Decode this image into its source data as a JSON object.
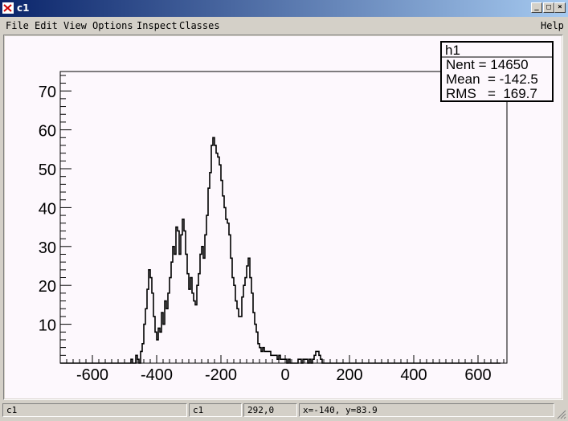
{
  "window": {
    "title": "c1"
  },
  "menu": {
    "items": [
      "File",
      "Edit",
      "View",
      "Options",
      "Inspect",
      "Classes"
    ],
    "help": "Help"
  },
  "stats_box": {
    "name": "h1",
    "lines": [
      "Nent = 14650",
      "Mean  = -142.5",
      "RMS   =  169.7"
    ]
  },
  "status": {
    "cells": [
      "c1",
      "c1",
      "292,0",
      "x=-140, y=83.9"
    ]
  },
  "chart_data": {
    "type": "histogram",
    "title": "",
    "xlabel": "",
    "ylabel": "",
    "xlim": [
      -700,
      690
    ],
    "ylim": [
      0,
      75
    ],
    "x_ticks": [
      -600,
      -400,
      -200,
      0,
      200,
      400,
      600
    ],
    "y_ticks": [
      10,
      20,
      30,
      40,
      50,
      60,
      70
    ],
    "bin_width": 5,
    "bin_start": -700,
    "values": [
      0,
      0,
      0,
      0,
      0,
      0,
      0,
      0,
      0,
      0,
      0,
      0,
      0,
      0,
      0,
      0,
      0,
      0,
      0,
      0,
      0,
      0,
      0,
      0,
      0,
      0,
      0,
      0,
      0,
      0,
      0,
      0,
      0,
      0,
      0,
      0,
      0,
      0,
      0,
      0,
      0,
      0,
      0,
      0,
      1,
      0,
      0,
      2,
      1,
      0,
      3,
      5,
      10,
      14,
      19,
      24,
      22,
      18,
      12,
      8,
      6,
      9,
      8,
      13,
      10,
      16,
      14,
      18,
      22,
      26,
      30,
      28,
      35,
      34,
      28,
      33,
      37,
      34,
      28,
      23,
      19,
      22,
      18,
      16,
      15,
      20,
      23,
      28,
      30,
      27,
      33,
      38,
      45,
      49,
      56,
      58,
      56,
      54,
      53,
      51,
      47,
      43,
      40,
      37,
      36,
      33,
      27,
      22,
      20,
      16,
      14,
      12,
      12,
      17,
      20,
      22,
      25,
      27,
      22,
      18,
      13,
      10,
      8,
      5,
      4,
      3,
      4,
      3,
      3,
      3,
      3,
      2,
      2,
      2,
      2,
      1,
      2,
      1,
      1,
      1,
      1,
      0,
      1,
      0,
      0,
      0,
      0,
      0,
      1,
      1,
      0,
      1,
      1,
      1,
      0,
      1,
      0,
      1,
      2,
      3,
      3,
      2,
      1,
      0,
      0,
      0,
      0,
      0,
      0,
      0,
      0,
      0,
      0,
      0,
      0,
      0,
      0,
      0,
      0,
      0,
      0,
      0,
      0,
      0,
      0,
      0,
      0,
      0,
      0,
      0,
      0,
      0,
      0,
      0,
      0,
      0,
      0,
      0,
      0,
      0,
      0,
      0,
      0,
      0,
      0,
      0,
      0,
      0,
      0,
      0,
      0,
      0,
      0,
      0,
      0,
      0,
      0,
      0,
      0,
      0,
      0,
      0,
      0,
      0,
      0,
      0,
      0,
      0,
      0,
      0,
      0,
      0,
      0,
      0,
      0,
      0,
      0,
      0,
      0,
      0,
      0,
      0,
      0,
      0,
      0,
      0,
      0,
      0,
      0,
      0,
      0,
      0,
      0,
      0,
      0,
      0,
      0,
      0,
      0,
      0,
      0,
      0,
      0,
      0,
      0,
      0,
      0,
      0,
      0,
      0,
      0,
      0,
      0,
      0
    ]
  }
}
